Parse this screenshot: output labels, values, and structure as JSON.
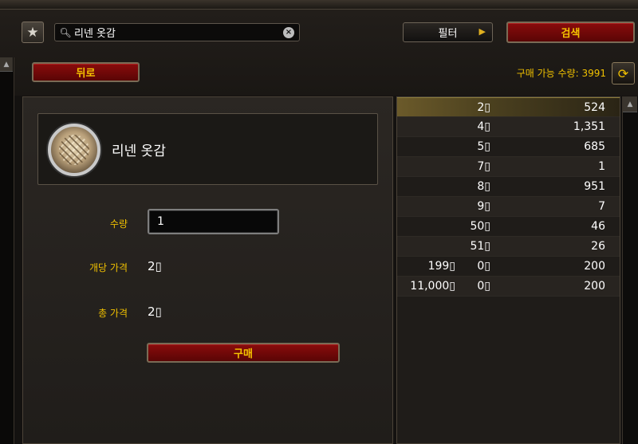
{
  "search": {
    "value": "리넨 옷감",
    "search_icon": "search-icon",
    "clear_icon": "close-icon"
  },
  "toolbar": {
    "favorite_icon": "star-icon",
    "filter_label": "필터",
    "search_button": "검색",
    "back_button": "뒤로",
    "purchasable_label": "구매 가능 수량: 3991",
    "refresh_icon": "refresh-icon"
  },
  "item": {
    "name": "리넨 옷감",
    "icon": "linen-cloth-icon"
  },
  "form": {
    "quantity_label": "수량",
    "quantity_value": "1",
    "unit_price_label": "개당 가격",
    "unit_price_value": "2",
    "total_price_label": "총 가격",
    "total_price_value": "2",
    "buy_button": "구매"
  },
  "listings": [
    {
      "gold": "",
      "silver": "2",
      "quantity": "524",
      "selected": true
    },
    {
      "gold": "",
      "silver": "4",
      "quantity": "1,351"
    },
    {
      "gold": "",
      "silver": "5",
      "quantity": "685"
    },
    {
      "gold": "",
      "silver": "7",
      "quantity": "1"
    },
    {
      "gold": "",
      "silver": "8",
      "quantity": "951"
    },
    {
      "gold": "",
      "silver": "9",
      "quantity": "7"
    },
    {
      "gold": "",
      "silver": "50",
      "quantity": "46"
    },
    {
      "gold": "",
      "silver": "51",
      "quantity": "26"
    },
    {
      "gold": "199",
      "silver": "0",
      "quantity": "200"
    },
    {
      "gold": "11,000",
      "silver": "0",
      "quantity": "200"
    }
  ],
  "colors": {
    "accent_gold": "#f0c000",
    "button_red": "#8a0c0c",
    "selected_row": "#6b5a2a"
  }
}
